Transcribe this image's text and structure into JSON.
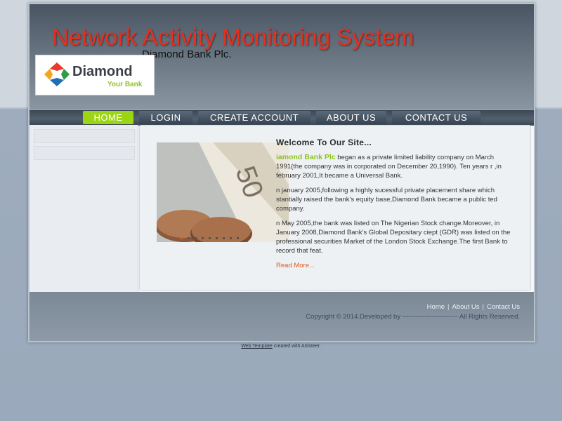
{
  "header": {
    "title": "Network Activity Monitoring System",
    "subtitle": "Diamond Bank Plc."
  },
  "logo": {
    "name": "Diamond",
    "tagline": "Your Bank",
    "colors": [
      "#e8392b",
      "#2e9c46",
      "#1f6fb2",
      "#f4a51c"
    ]
  },
  "nav": {
    "items": [
      {
        "label": "HOME",
        "active": true
      },
      {
        "label": "LOGIN",
        "active": false
      },
      {
        "label": "CREATE ACCOUNT",
        "active": false
      },
      {
        "label": "ABOUT US",
        "active": false
      },
      {
        "label": "CONTACT US",
        "active": false
      }
    ]
  },
  "content": {
    "heading": "Welcome To Our Site...",
    "para1_highlight": "iamond Bank Plc",
    "para1": " began as a private limited liability company on March 1991(the company was in corporated on December 20,1990). Ten years r ,in february 2001,It became a Universal Bank.",
    "para2": "n january 2005,following a highly sucessful private placement share which stantially raised the bank's equity base,Diamond Bank became a public ted company.",
    "para3": "n May 2005,the bank was listed on The Nigerian Stock change.Moreover, in January 2008,Diamond Bank's Global Depositary ciept (GDR) was listed on the professional securities Market of  the London Stock Exchange.The first  Bank to record that feat.",
    "read_more": "Read More..."
  },
  "footer": {
    "links": [
      "Home",
      "About Us",
      "Contact Us"
    ],
    "copyright": "Copyright © 2014.Developed by ------------------------- All Rights Reserved."
  },
  "credit": {
    "link": "Web Template",
    "text": " created with Artisteer."
  },
  "colors": {
    "title": "#e8301f",
    "nav_active": "#9bd514",
    "highlight": "#8dc21f",
    "read_more": "#e25a1c"
  }
}
